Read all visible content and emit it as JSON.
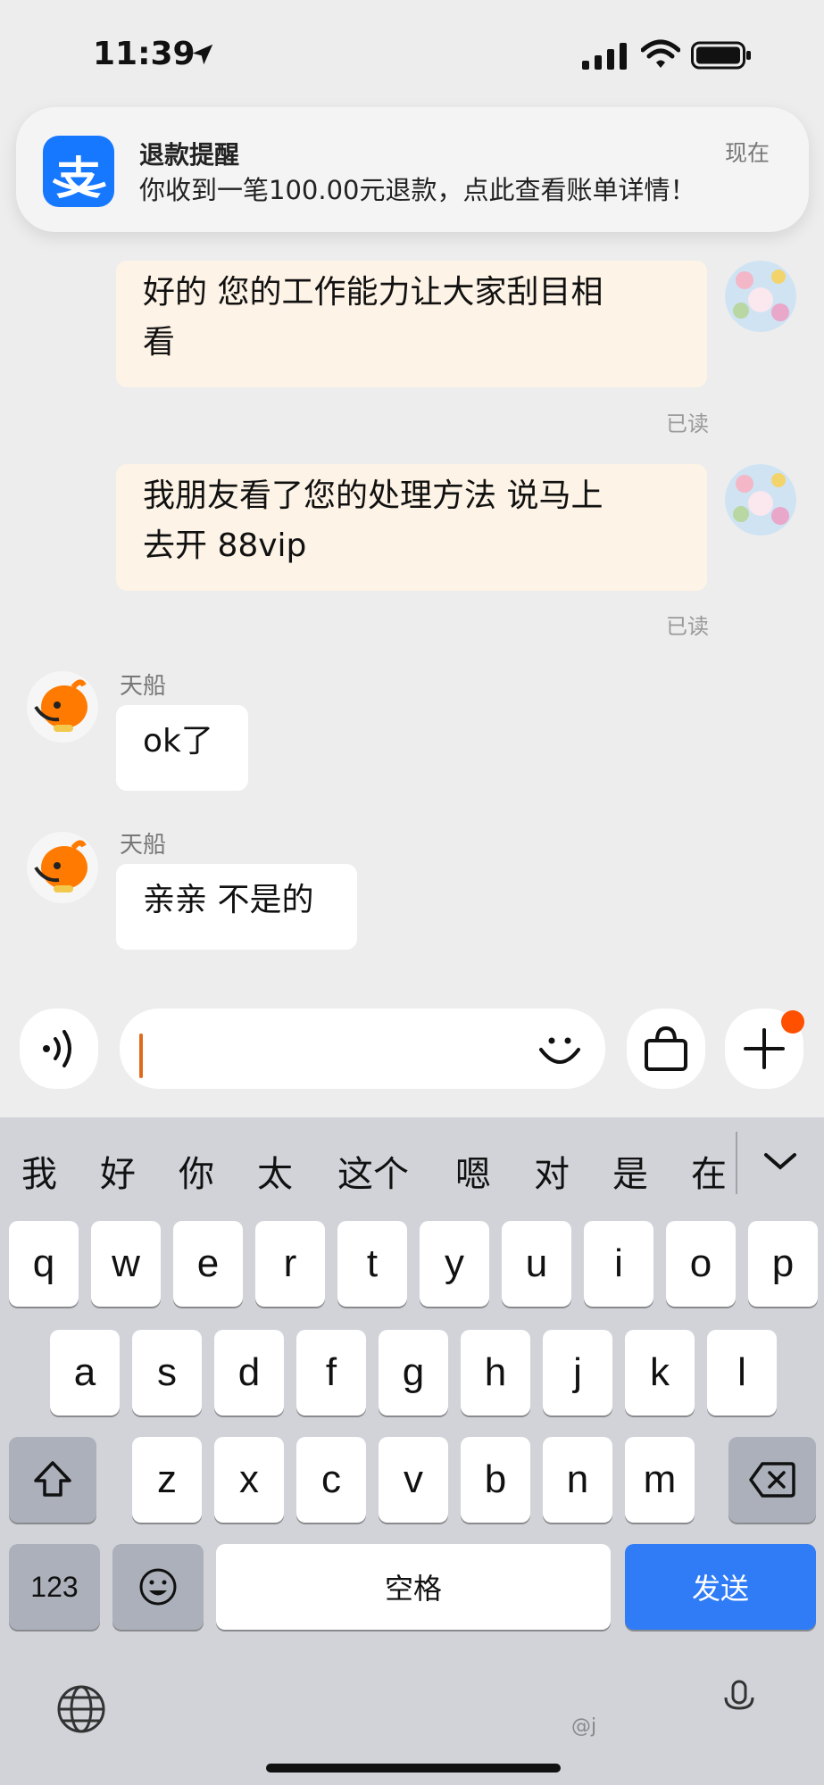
{
  "status_bar": {
    "time": "11:39"
  },
  "notification": {
    "title": "退款提醒",
    "body": "你收到一笔100.00元退款，点此查看账单详情！",
    "time": "现在",
    "app_icon_char": "支"
  },
  "messages": [
    {
      "text_line1": "好的 您的工作能力让大家刮目相",
      "text_line2": "看",
      "read": "已读"
    },
    {
      "text_line1": "我朋友看了您的处理方法 说马上",
      "text_line2": "去开 88vip",
      "read": "已读"
    },
    {
      "sender": "天船",
      "text": "ok了"
    },
    {
      "sender": "天船",
      "text": "亲亲 不是的"
    }
  ],
  "candidates": [
    "我",
    "好",
    "你",
    "太",
    "这个",
    "嗯",
    "对",
    "是",
    "在"
  ],
  "keyboard": {
    "row1": [
      "q",
      "w",
      "e",
      "r",
      "t",
      "y",
      "u",
      "i",
      "o",
      "p"
    ],
    "row2": [
      "a",
      "s",
      "d",
      "f",
      "g",
      "h",
      "j",
      "k",
      "l"
    ],
    "row3": [
      "z",
      "x",
      "c",
      "v",
      "b",
      "n",
      "m"
    ],
    "numbers_label": "123",
    "space_label": "空格",
    "send_label": "发送"
  },
  "watermark": "@j",
  "colors": {
    "accent_orange": "#ff5000",
    "send_blue": "#2f7cf6",
    "alipay_blue": "#1677ff",
    "my_bubble": "#fdf3e6"
  },
  "icons": [
    "location-arrow-icon",
    "signal-icon",
    "wifi-icon",
    "battery-icon",
    "voice-icon",
    "emoji-face-icon",
    "shopping-bag-icon",
    "plus-icon",
    "shift-icon",
    "backspace-icon",
    "emoji-icon",
    "globe-icon",
    "mic-icon",
    "chevron-down-icon"
  ]
}
